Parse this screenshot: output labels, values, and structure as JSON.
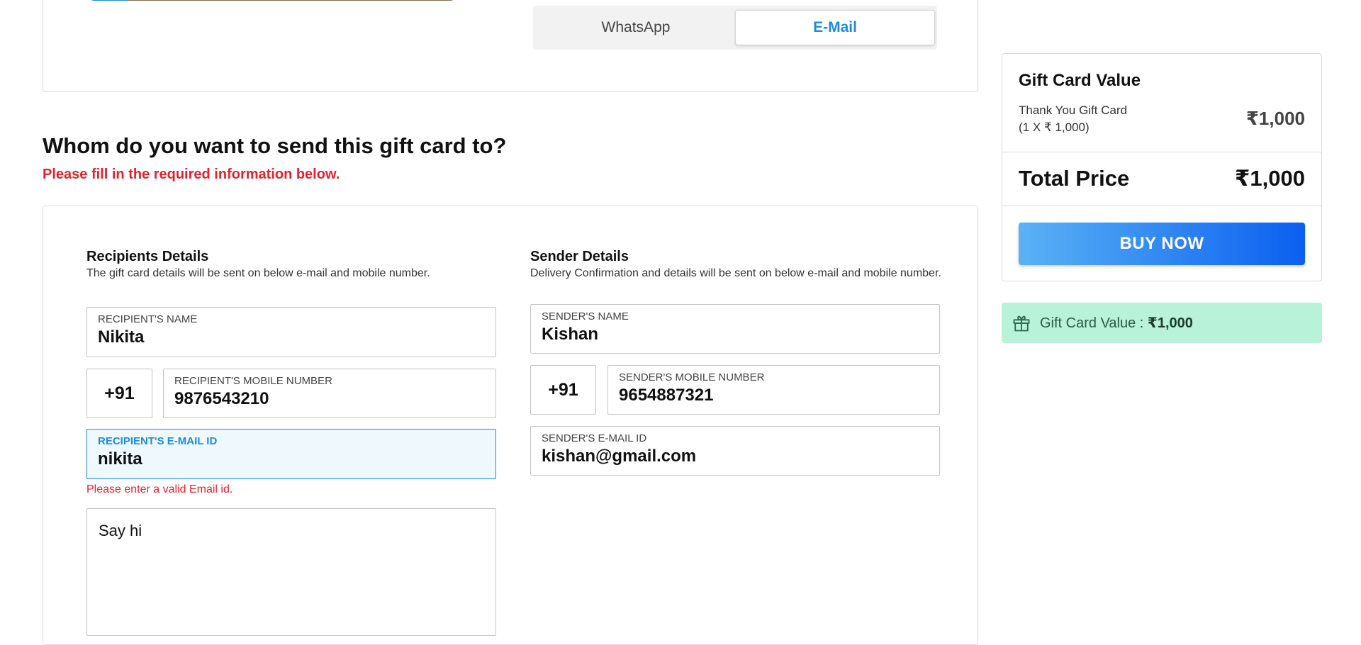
{
  "channel_toggle": {
    "options": [
      "WhatsApp",
      "E-Mail"
    ],
    "selected": "E-Mail"
  },
  "heading": {
    "title": "Whom do you want to send this gift card to?",
    "subtitle": "Please fill in the required information below."
  },
  "recipient": {
    "section_title": "Recipients Details",
    "section_desc": "The gift card details will be sent on below e-mail and mobile number.",
    "name_label": "RECIPIENT'S NAME",
    "name_value": "Nikita",
    "country_code": "+91",
    "mobile_label": "RECIPIENT'S MOBILE NUMBER",
    "mobile_value": "9876543210",
    "email_label": "RECIPIENT'S E-MAIL ID",
    "email_value": "nikita",
    "email_error": "Please enter a valid Email id.",
    "message_value": "Say hi"
  },
  "sender": {
    "section_title": "Sender Details",
    "section_desc": "Delivery Confirmation and details will be sent on below e-mail and mobile number.",
    "name_label": "SENDER'S NAME",
    "name_value": "Kishan",
    "country_code": "+91",
    "mobile_label": "SENDER'S MOBILE NUMBER",
    "mobile_value": "9654887321",
    "email_label": "SENDER'S E-MAIL ID",
    "email_value": "kishan@gmail.com"
  },
  "summary": {
    "title": "Gift Card Value",
    "item_name": "Thank You Gift Card",
    "item_qty": "(1 X ₹ 1,000)",
    "item_price": "₹1,000",
    "total_label": "Total Price",
    "total_price": "₹1,000",
    "buy_label": "BUY NOW"
  },
  "gift_banner": {
    "label": "Gift Card Value :",
    "value": "₹1,000",
    "icon": "gift-icon"
  }
}
